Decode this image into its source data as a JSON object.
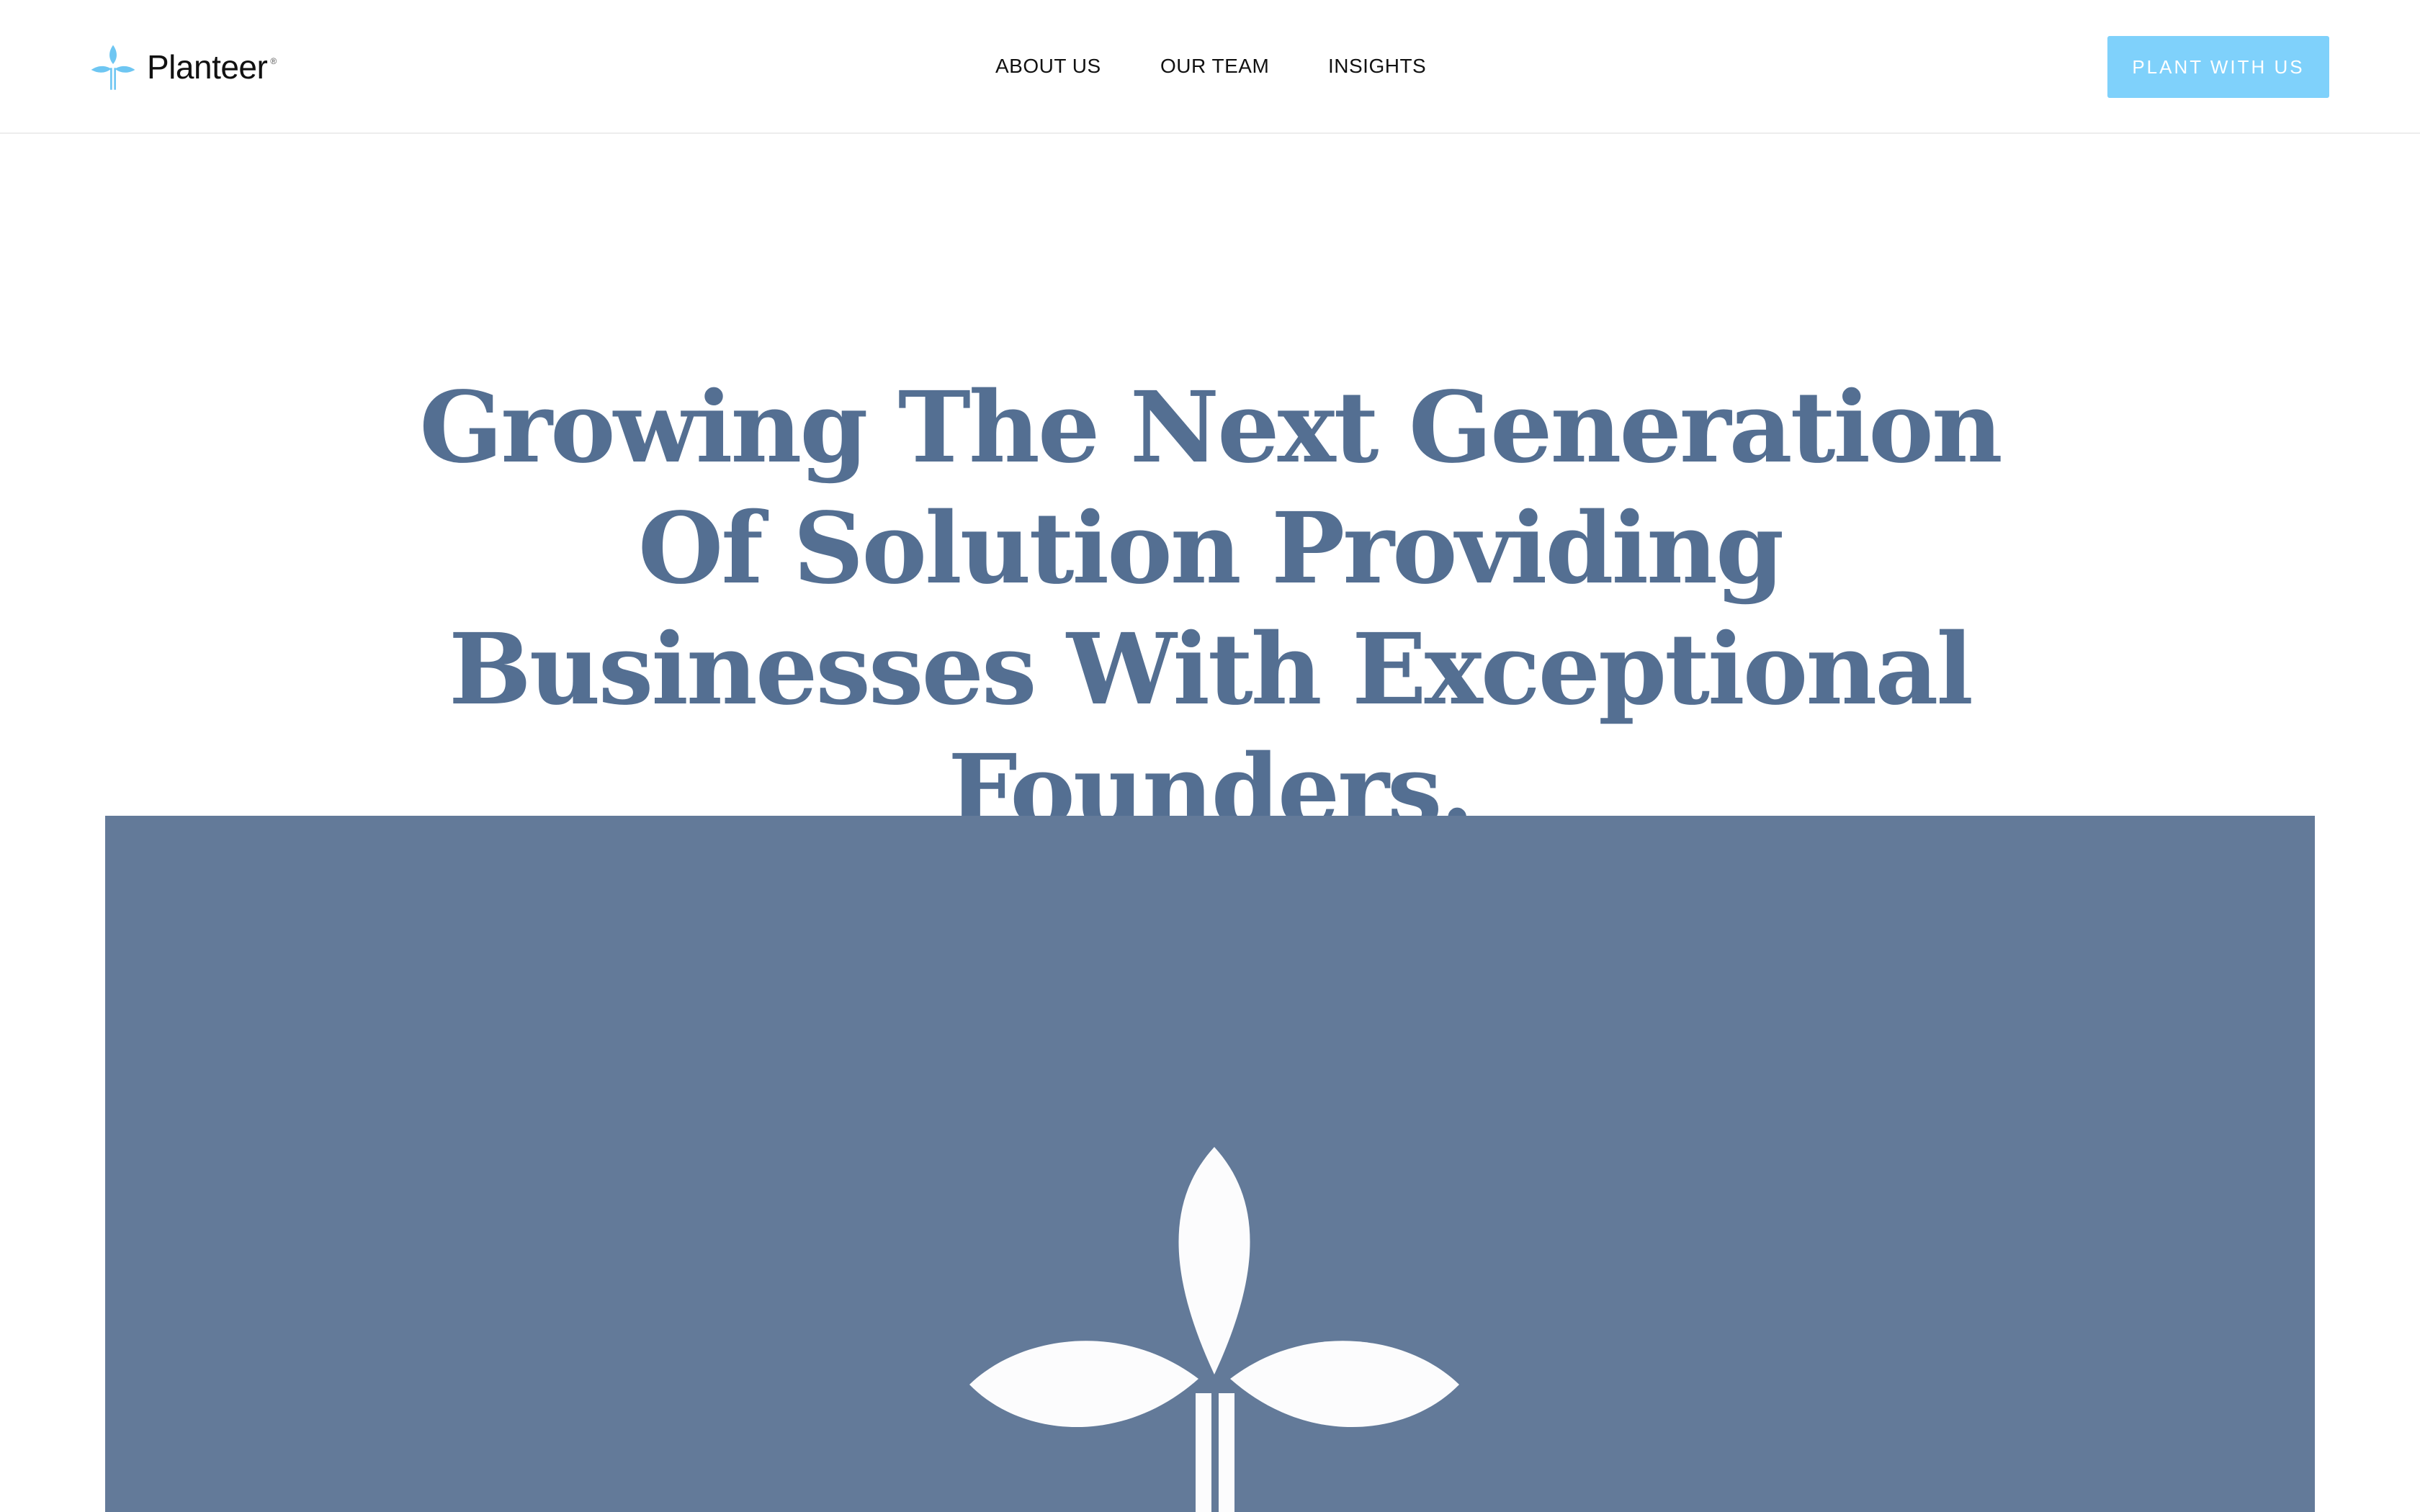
{
  "header": {
    "logo_text": "Planteer",
    "logo_reg": "®",
    "nav": [
      {
        "label": "ABOUT US"
      },
      {
        "label": "OUR TEAM"
      },
      {
        "label": "INSIGHTS"
      }
    ],
    "cta_label": "PLANT WITH US"
  },
  "hero": {
    "title": "Growing The Next Generation Of Solution Providing Businesses With Exceptional Founders.",
    "image_icon": "sprout-logo-icon"
  },
  "colors": {
    "accent": "#7fd1fb",
    "heading": "#546f92",
    "hero_background": "#637a99"
  }
}
